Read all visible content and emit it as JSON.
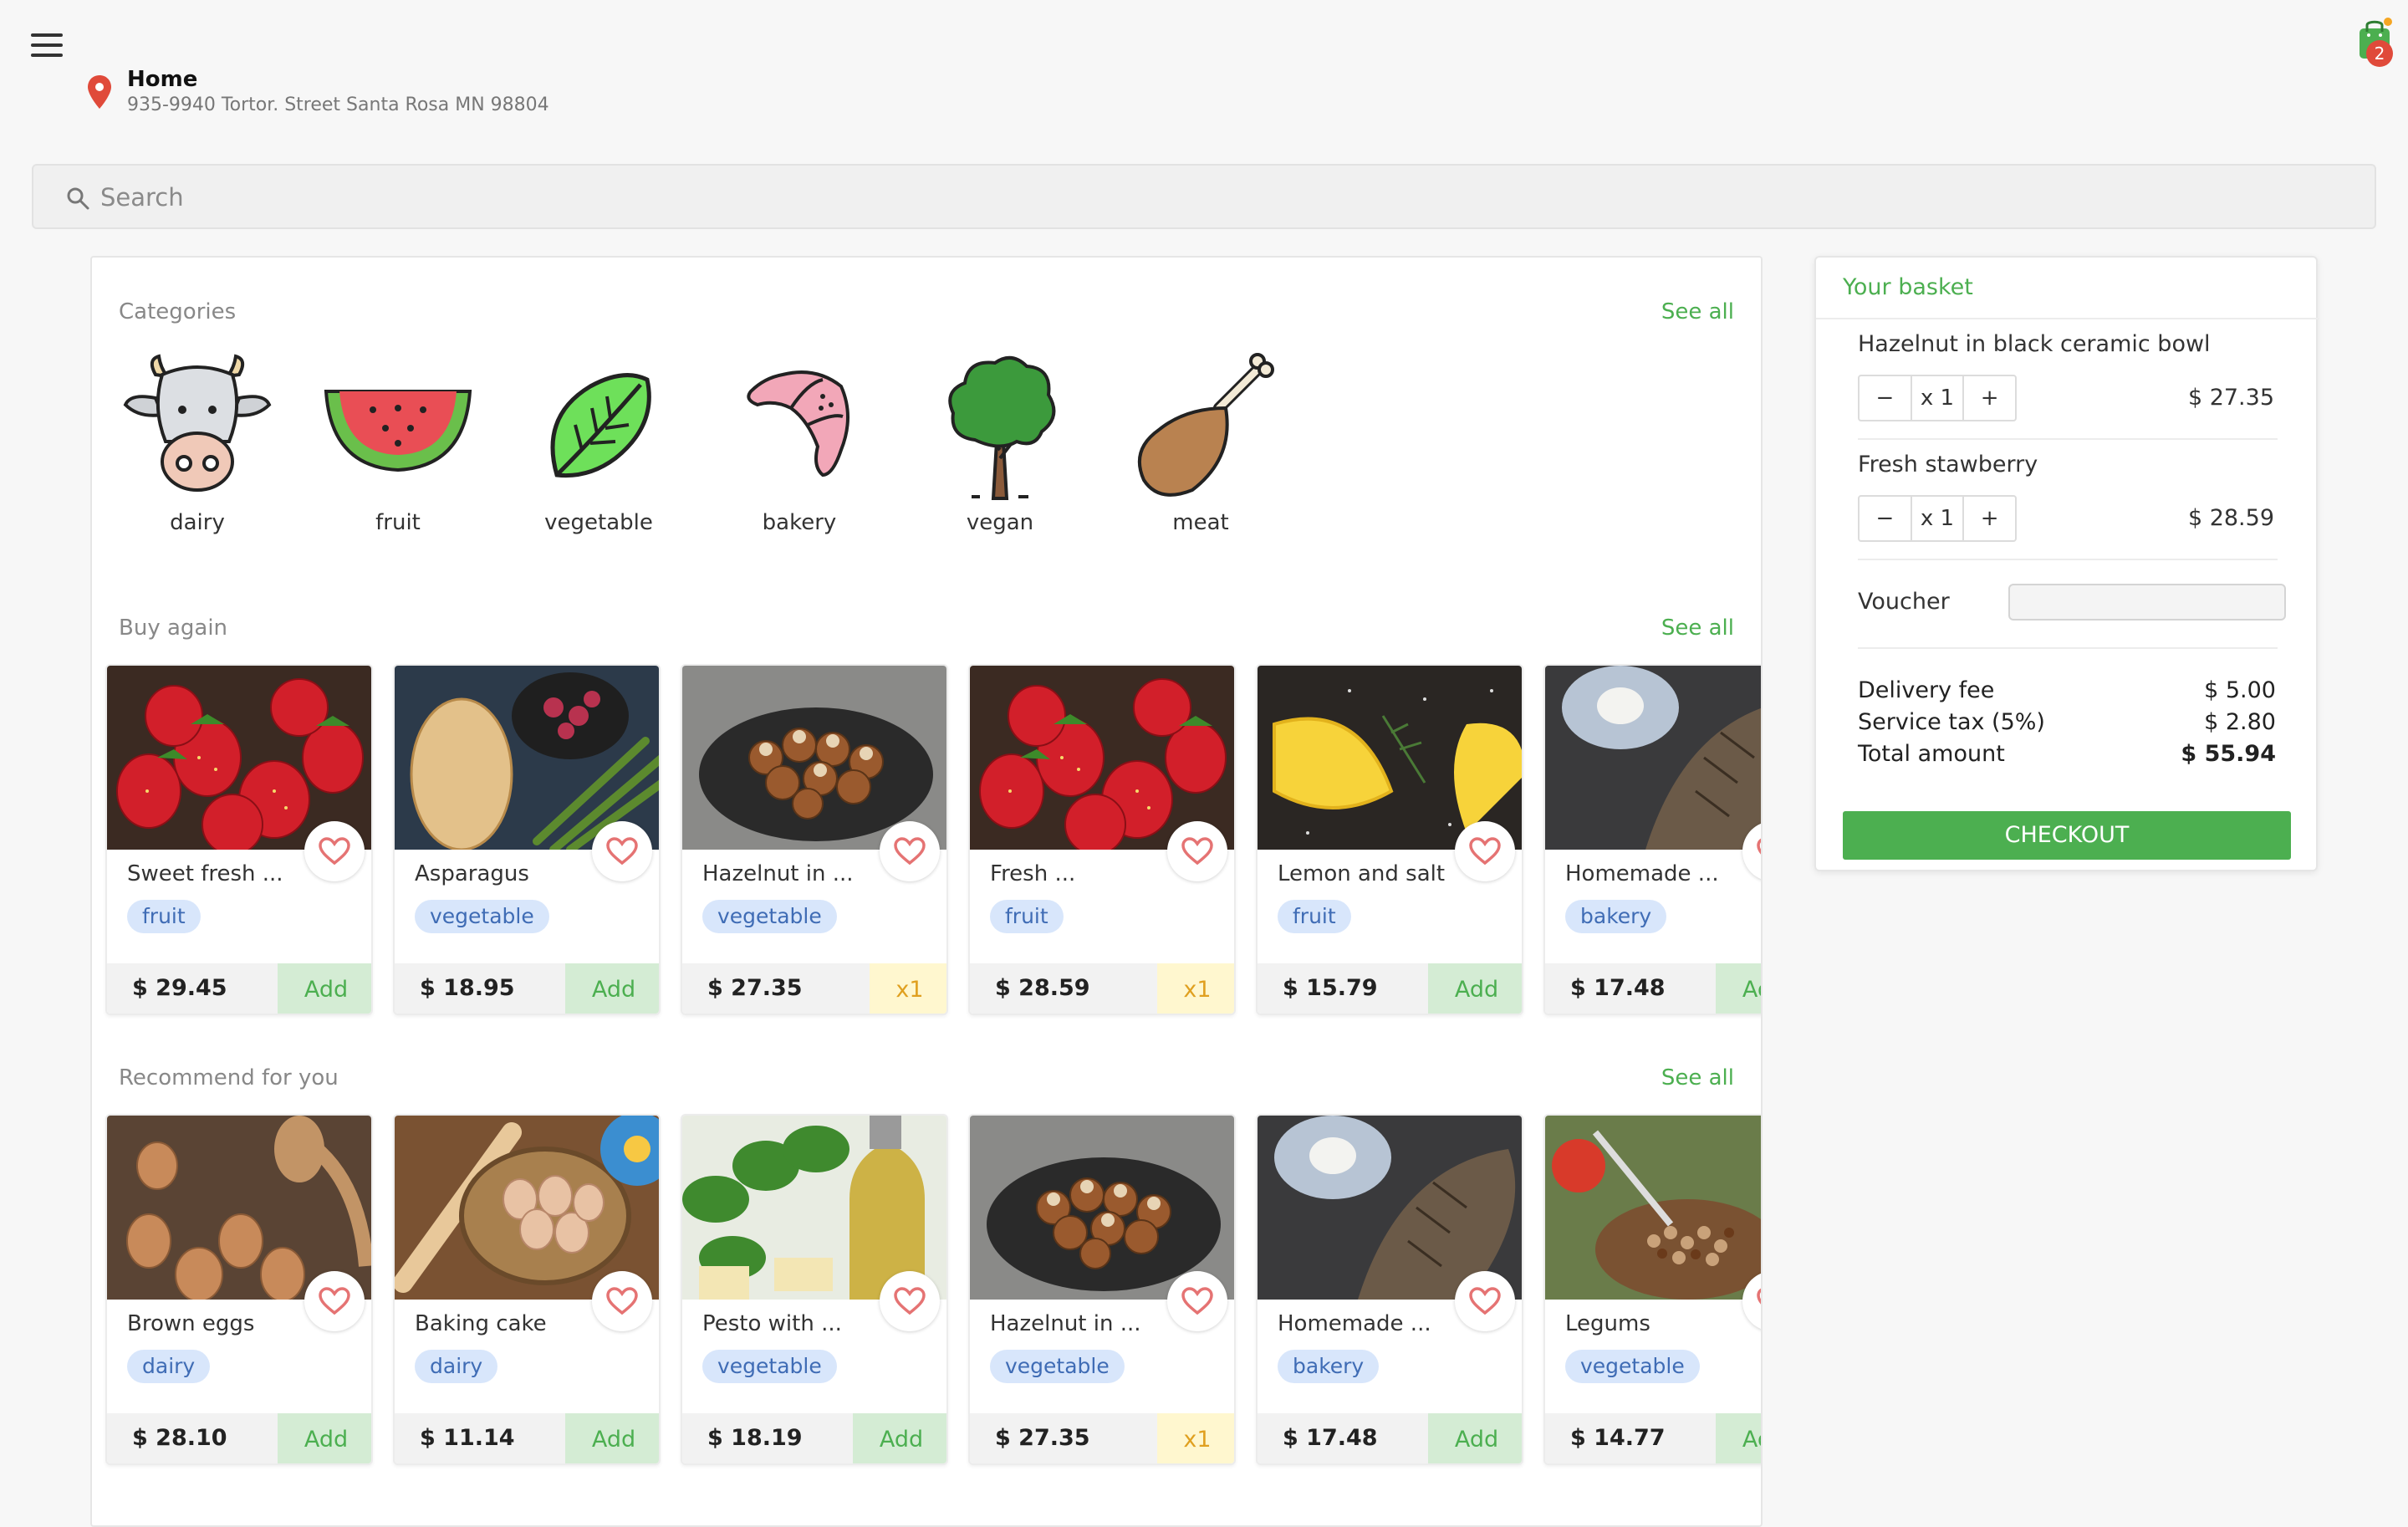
{
  "header": {
    "location_title": "Home",
    "location_address": "935-9940 Tortor. Street Santa Rosa MN 98804",
    "cart_count": "2"
  },
  "search": {
    "placeholder": "Search"
  },
  "categories": {
    "title": "Categories",
    "see_all": "See all",
    "items": [
      {
        "label": "dairy",
        "icon": "cow-icon"
      },
      {
        "label": "fruit",
        "icon": "watermelon-icon"
      },
      {
        "label": "vegetable",
        "icon": "leaf-icon"
      },
      {
        "label": "bakery",
        "icon": "croissant-icon"
      },
      {
        "label": "vegan",
        "icon": "tree-icon"
      },
      {
        "label": "meat",
        "icon": "drumstick-icon"
      }
    ]
  },
  "buy_again": {
    "title": "Buy again",
    "see_all": "See all",
    "items": [
      {
        "name": "Sweet fresh ...",
        "tag": "fruit",
        "price": "$ 29.45",
        "action": "Add",
        "image": "strawberries-photo"
      },
      {
        "name": "Asparagus",
        "tag": "vegetable",
        "price": "$ 18.95",
        "action": "Add",
        "image": "asparagus-photo"
      },
      {
        "name": "Hazelnut in ...",
        "tag": "vegetable",
        "price": "$ 27.35",
        "action": "x1",
        "image": "hazelnut-photo"
      },
      {
        "name": "Fresh ...",
        "tag": "fruit",
        "price": "$ 28.59",
        "action": "x1",
        "image": "strawberries-photo"
      },
      {
        "name": "Lemon and salt",
        "tag": "fruit",
        "price": "$ 15.79",
        "action": "Add",
        "image": "lemon-photo"
      },
      {
        "name": "Homemade ...",
        "tag": "bakery",
        "price": "$ 17.48",
        "action": "Add",
        "image": "bread-photo"
      }
    ]
  },
  "recommend": {
    "title": "Recommend for you",
    "see_all": "See all",
    "items": [
      {
        "name": "Brown eggs",
        "tag": "dairy",
        "price": "$ 28.10",
        "action": "Add",
        "image": "eggs-photo"
      },
      {
        "name": "Baking cake",
        "tag": "dairy",
        "price": "$ 11.14",
        "action": "Add",
        "image": "eggs-basket-photo"
      },
      {
        "name": "Pesto with ...",
        "tag": "vegetable",
        "price": "$ 18.19",
        "action": "Add",
        "image": "pesto-photo"
      },
      {
        "name": "Hazelnut in ...",
        "tag": "vegetable",
        "price": "$ 27.35",
        "action": "x1",
        "image": "hazelnut-photo"
      },
      {
        "name": "Homemade ...",
        "tag": "bakery",
        "price": "$ 17.48",
        "action": "Add",
        "image": "bread-photo"
      },
      {
        "name": "Legums",
        "tag": "vegetable",
        "price": "$ 14.77",
        "action": "Add",
        "image": "legumes-photo"
      }
    ]
  },
  "basket": {
    "title": "Your basket",
    "items": [
      {
        "name": "Hazelnut in black ceramic bowl",
        "qty": "x 1",
        "price": "$ 27.35",
        "minus": "−",
        "plus": "+"
      },
      {
        "name": "Fresh stawberry",
        "qty": "x 1",
        "price": "$ 28.59",
        "minus": "−",
        "plus": "+"
      }
    ],
    "voucher_label": "Voucher",
    "voucher_value": "",
    "delivery_label": "Delivery fee",
    "delivery_value": "$ 5.00",
    "tax_label": "Service tax (5%)",
    "tax_value": "$ 2.80",
    "total_label": "Total amount",
    "total_value": "$ 55.94",
    "checkout": "CHECKOUT"
  },
  "colors": {
    "accent": "#4caf50",
    "tag_bg": "#d8e6fb",
    "tag_text": "#3f6cb5",
    "badge": "#e04a3a",
    "heart": "#e57373",
    "qty_bg": "#fff7cf",
    "qty_text": "#e0a020"
  }
}
